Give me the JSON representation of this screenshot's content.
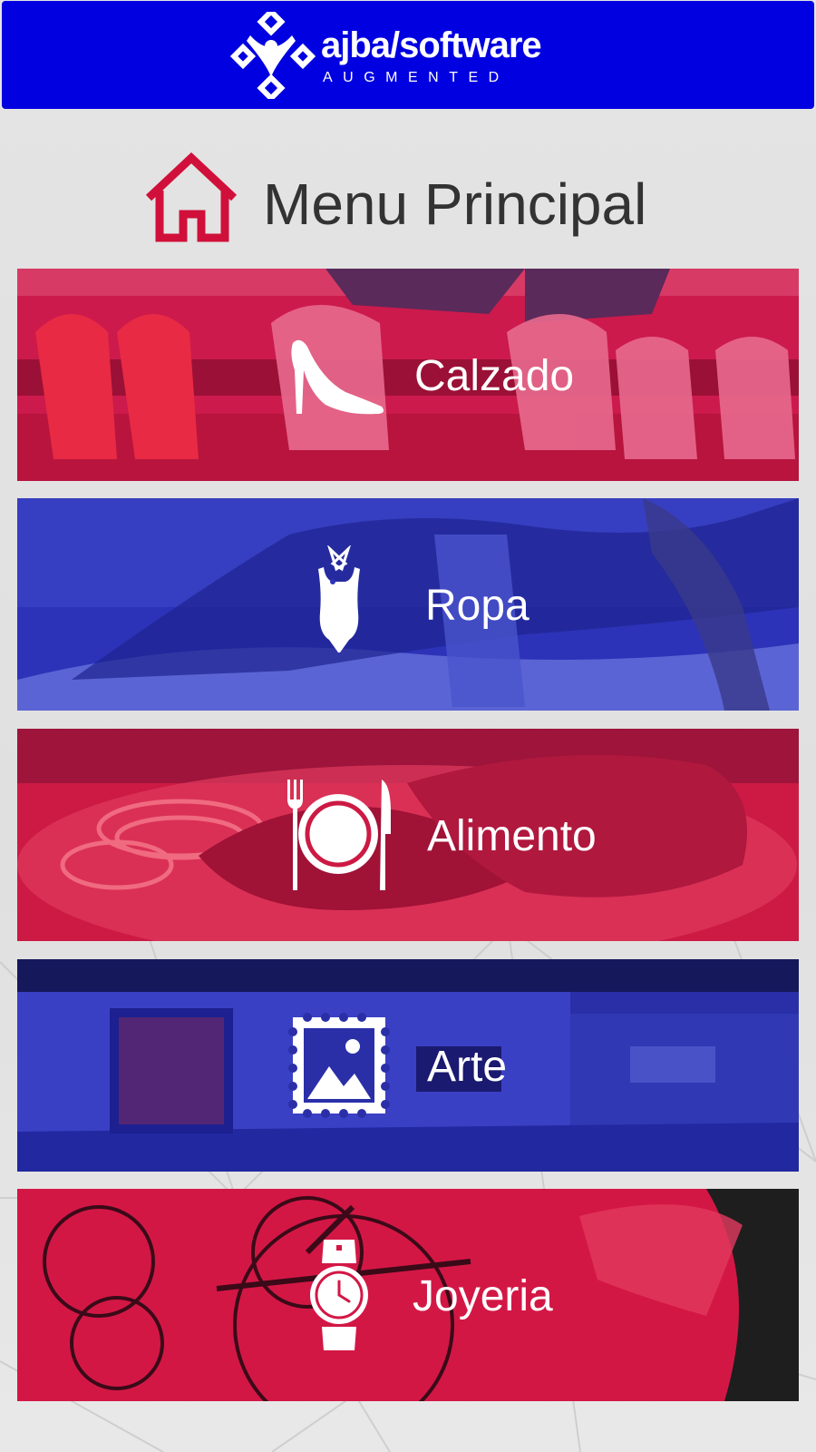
{
  "header": {
    "logo_title": "ajba/software",
    "logo_subtitle": "AUGMENTED"
  },
  "page": {
    "title": "Menu Principal",
    "icon": "home-icon"
  },
  "menu": [
    {
      "label": "Calzado",
      "icon": "high-heel-icon",
      "tint": "#d21a52"
    },
    {
      "label": "Ropa",
      "icon": "swimsuit-icon",
      "tint": "#2c33b8"
    },
    {
      "label": "Alimento",
      "icon": "plate-cutlery-icon",
      "tint": "#cc1a44"
    },
    {
      "label": "Arte",
      "icon": "picture-stamp-icon",
      "tint": "#2a2fa8"
    },
    {
      "label": "Joyeria",
      "icon": "wristwatch-icon",
      "tint": "#d31745"
    }
  ],
  "colors": {
    "header_bg": "#0000e0",
    "accent_red": "#d0103a",
    "accent_blue": "#2c33b8"
  }
}
